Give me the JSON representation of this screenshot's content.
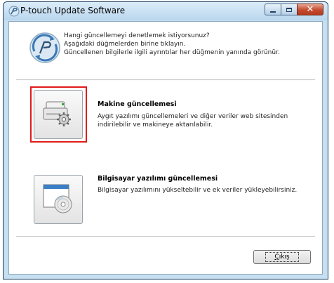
{
  "window": {
    "title": "P-touch Update Software",
    "icon": "p-touch-logo-icon"
  },
  "caption": {
    "minimize_icon": "minimize-icon",
    "maximize_icon": "maximize-icon",
    "close_icon": "close-icon",
    "close_glyph": "✕"
  },
  "instructions": {
    "line1": "Hangi güncellemeyi denetlemek istiyorsunuz?",
    "line2": "Aşağıdaki düğmelerden birine tıklayın.",
    "line3": "Güncellenen bilgilerle ilgili ayrıntılar her düğmenin yanında görünür."
  },
  "options": [
    {
      "title": "Makine güncellemesi",
      "desc_line1": "Aygıt yazılımı güncellemeleri ve diğer veriler web sitesinden",
      "desc_line2": "indirilebilir ve makineye aktarılabilir.",
      "icon": "printer-gear-icon",
      "highlighted": true
    },
    {
      "title": "Bilgisayar yazılımı güncellemesi",
      "desc_line1": "Bilgisayar yazılımını yükseltebilir ve ek veriler yükleyebilirsiniz.",
      "icon": "computer-cd-icon",
      "highlighted": false
    }
  ],
  "cancel": {
    "label_accel": "Ç",
    "label_rest": "ıkış"
  },
  "colors": {
    "highlight": "#e11a1a",
    "titlebar": "#c6dff1"
  }
}
